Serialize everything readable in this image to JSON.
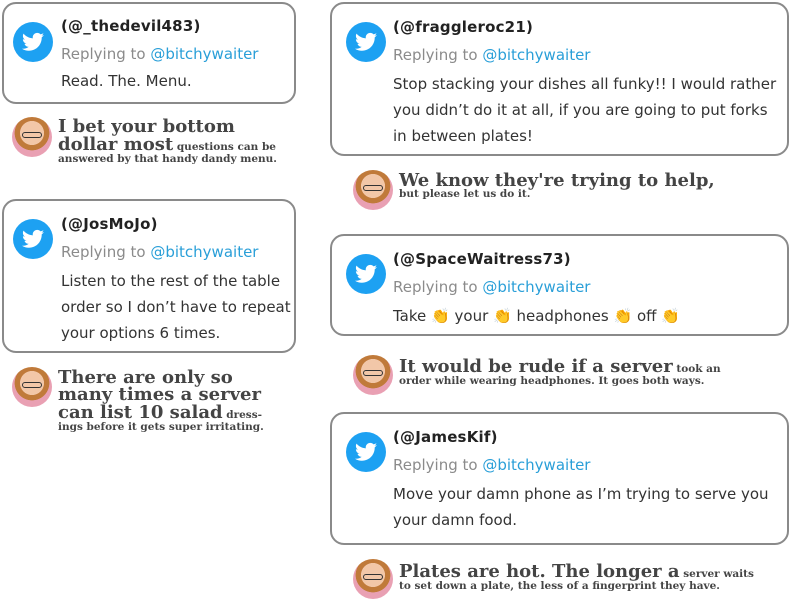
{
  "tweets": [
    {
      "handle": "(@_thedevil483)",
      "replying_prefix": "Replying to",
      "replying_handle": "@bitchywaiter",
      "body": [
        "Read. The. Menu."
      ]
    },
    {
      "handle": "(@JosMoJo)",
      "replying_prefix": "Replying to",
      "replying_handle": "@bitchywaiter",
      "body": [
        "Listen to the rest of the table",
        "order so I don’t have to repeat",
        "your options 6 times."
      ]
    },
    {
      "handle": "(@fraggleroc21)",
      "replying_prefix": "Replying to",
      "replying_handle": "@bitchywaiter",
      "body": [
        "Stop stacking your dishes all funky!! I would rather",
        "you didn’t do it at all, if you are going to put forks",
        "in between plates!"
      ]
    },
    {
      "handle": "(@SpaceWaitress73)",
      "replying_prefix": "Replying to",
      "replying_handle": "@bitchywaiter",
      "body_words": [
        "Take",
        "your",
        "headphones",
        "off"
      ],
      "clap": "👏"
    },
    {
      "handle": "(@JamesKif)",
      "replying_prefix": "Replying to",
      "replying_handle": "@bitchywaiter",
      "body": [
        "Move your damn phone as I’m trying to serve you",
        "your damn food."
      ]
    }
  ],
  "comments": [
    {
      "big1": "I bet your bottom",
      "big2": "dollar most",
      "small2": " questions can be",
      "small3": "answered by that handy dandy menu."
    },
    {
      "big1": "There are only so",
      "big2": "many times a server",
      "big3": "can list 10 salad",
      "small3": " dress-",
      "small4": "ings before it gets super irritating."
    },
    {
      "big1": "We know they're trying to help,",
      "small2": "but please let us do it."
    },
    {
      "big1": "It would be rude if a server",
      "small1": " took an",
      "small2": "order while wearing headphones. It goes both ways."
    },
    {
      "big1": "Plates are hot. The longer a",
      "small1": " server waits",
      "small2": "to set down a plate, the less of a fingerprint they have."
    }
  ],
  "icons": {
    "twitter": "twitter-bird-icon",
    "avatar": "author-avatar"
  },
  "colors": {
    "twitter_blue": "#1da1f2",
    "link": "#2a9fd8",
    "border": "#8a8a8a"
  }
}
